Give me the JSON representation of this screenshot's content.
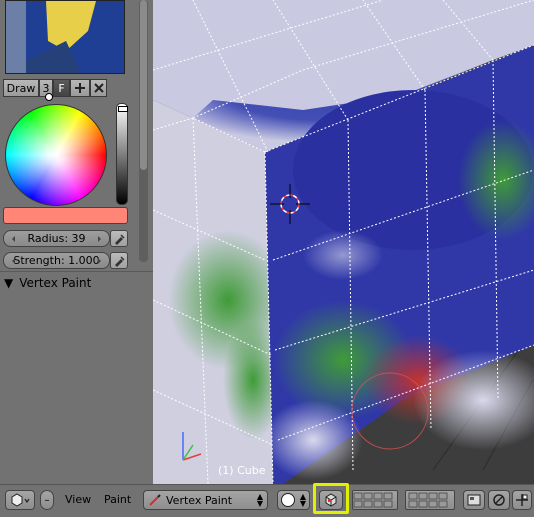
{
  "tool_panel": {
    "brush_name": "Draw",
    "brush_users": "3",
    "fake_user": "F",
    "add_icon": "plus-icon",
    "delete_icon": "x-icon",
    "color_hex": "#ff8576",
    "radius_label": "Radius: 39",
    "strength_label": "Strength: 1.000",
    "panel_title": "Vertex Paint"
  },
  "viewport": {
    "object_info": "(1) Cube"
  },
  "header": {
    "view_menu": "View",
    "paint_menu": "Paint",
    "mode_label": "Vertex Paint",
    "highlight_color": "#e0f000"
  }
}
